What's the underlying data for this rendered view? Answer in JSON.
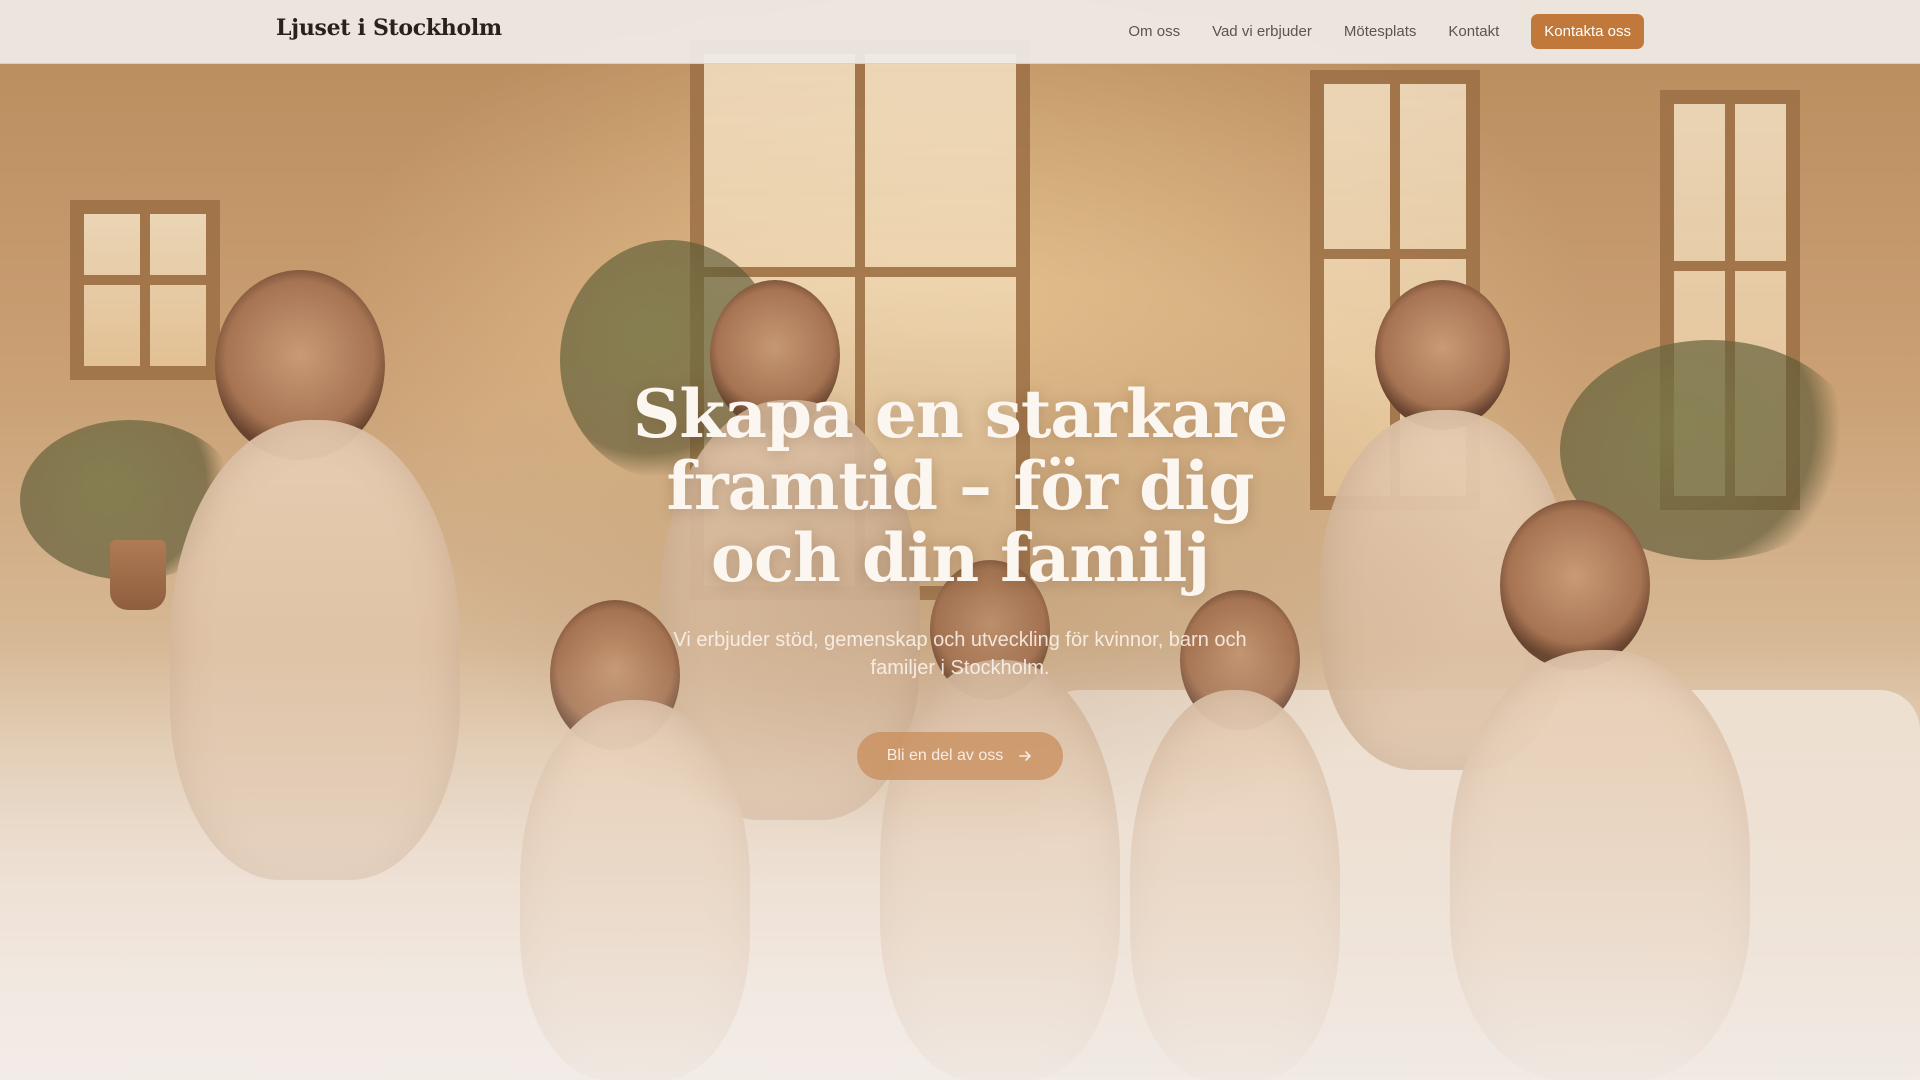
{
  "header": {
    "brand": "Ljuset i Stockholm",
    "nav": [
      {
        "label": "Om oss"
      },
      {
        "label": "Vad vi erbjuder"
      },
      {
        "label": "Mötesplats"
      },
      {
        "label": "Kontakt"
      }
    ],
    "cta_label": "Kontakta oss"
  },
  "hero": {
    "title": "Skapa en starkare framtid – för dig och din familj",
    "subtitle": "Vi erbjuder stöd, gemenskap och utveckling för kvinnor, barn och familjer i Stockholm.",
    "button_label": "Bli en del av oss",
    "button_icon": "arrow-right-icon"
  },
  "colors": {
    "accent": "#c0793b",
    "brand_text": "#2b211b",
    "nav_text": "#5e544e",
    "hero_text": "#fbf6f0"
  }
}
